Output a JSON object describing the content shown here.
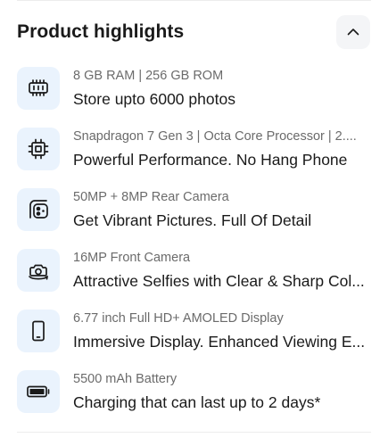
{
  "section": {
    "title": "Product highlights",
    "collapse_icon": "chevron-up-icon"
  },
  "highlights": [
    {
      "icon": "ram-chip-icon",
      "subtitle": "8 GB RAM | 256 GB ROM",
      "headline": "Store upto 6000 photos"
    },
    {
      "icon": "processor-icon",
      "subtitle": "Snapdragon 7 Gen 3 | Octa Core Processor | 2....",
      "headline": "Powerful Performance. No Hang Phone"
    },
    {
      "icon": "rear-camera-icon",
      "subtitle": "50MP + 8MP Rear Camera",
      "headline": "Get Vibrant Pictures. Full Of Detail"
    },
    {
      "icon": "front-camera-icon",
      "subtitle": "16MP Front Camera",
      "headline": "Attractive Selfies with Clear & Sharp Col..."
    },
    {
      "icon": "display-icon",
      "subtitle": "6.77 inch Full HD+ AMOLED Display",
      "headline": "Immersive Display. Enhanced Viewing E..."
    },
    {
      "icon": "battery-icon",
      "subtitle": "5500 mAh Battery",
      "headline": "Charging that can last up to 2 days*"
    }
  ]
}
